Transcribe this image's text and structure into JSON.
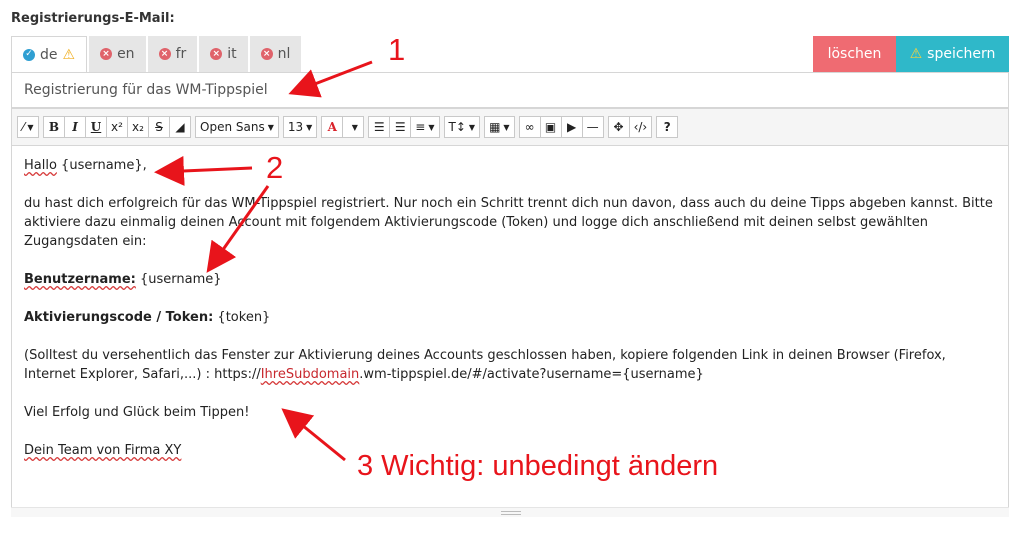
{
  "section_label": "Registrierungs-E-Mail:",
  "tabs": [
    {
      "code": "de",
      "status": "ok",
      "warning": true
    },
    {
      "code": "en",
      "status": "missing"
    },
    {
      "code": "fr",
      "status": "missing"
    },
    {
      "code": "it",
      "status": "missing"
    },
    {
      "code": "nl",
      "status": "missing"
    }
  ],
  "buttons": {
    "delete": "löschen",
    "save": "speichern"
  },
  "subject": "Registrierung für das WM-Tippspiel",
  "toolbar": {
    "font_family": "Open Sans",
    "font_size": "13",
    "color_letter": "A",
    "bold": "B",
    "italic": "I",
    "underline": "U",
    "sup": "x²",
    "sub": "x₂",
    "strike": "S",
    "help": "?"
  },
  "body": {
    "greeting_a": "Hallo",
    "greeting_b": " {username},",
    "p1": "du hast dich erfolgreich für das WM-Tippspiel registriert. Nur noch ein Schritt trennt dich nun davon, dass auch du deine Tipps abgeben kannst. Bitte aktiviere dazu einmalig deinen Account mit folgendem Aktivierungscode (Token) und logge dich anschließend mit deinen selbst gewählten Zugangsdaten ein:",
    "username_label": "Benutzername:",
    "username_value": " {username}",
    "token_label": "Aktivierungscode / Token:",
    "token_value": " {token}",
    "p2_a": "(Solltest du versehentlich das Fenster zur Aktivierung deines Accounts geschlossen haben, kopiere folgenden Link in deinen Browser (Firefox, Internet Explorer, Safari,...) : https://",
    "p2_sub": "IhreSubdomain",
    "p2_b": ".wm-tippspiel.de/#/activate?username={username}",
    "closing": "Viel Erfolg und Glück beim Tippen!",
    "signature": "Dein Team von Firma XY"
  },
  "annotations": {
    "n1": "1",
    "n2": "2",
    "n3": "3 Wichtig: unbedingt ändern",
    "color": "#e8141b"
  }
}
